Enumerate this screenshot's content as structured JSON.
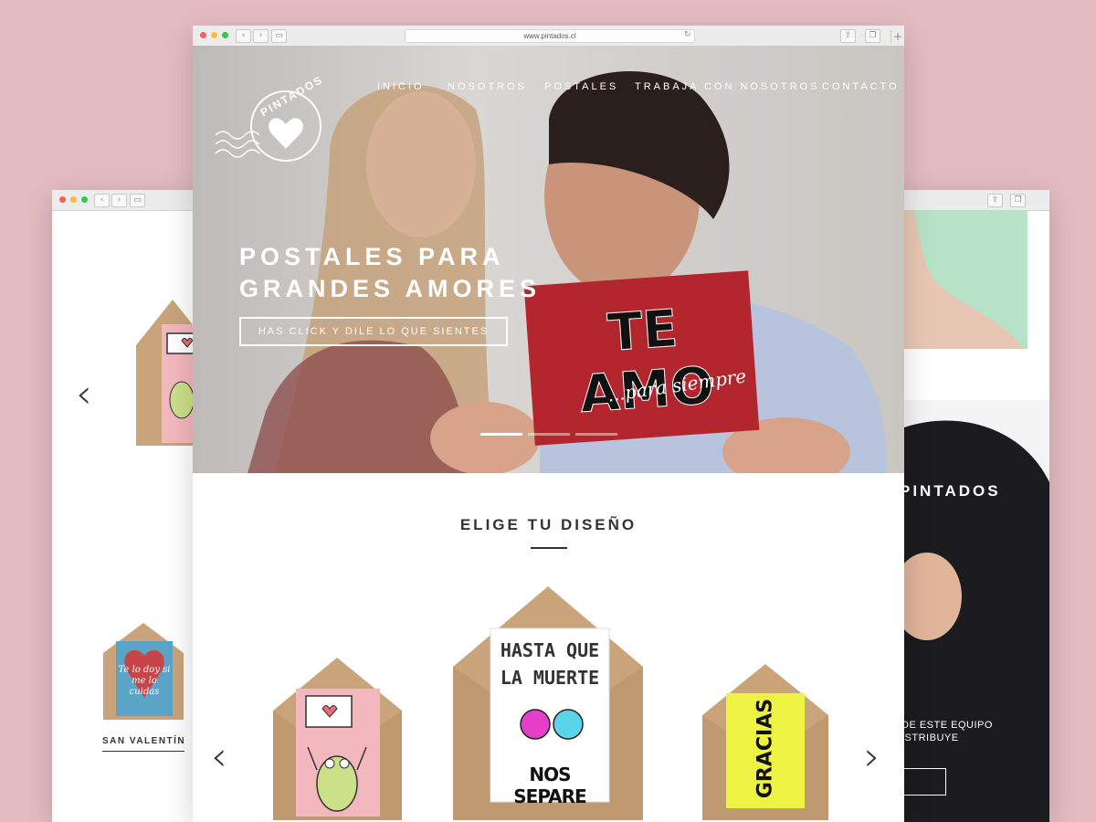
{
  "browser": {
    "url": "www.pintados.cl",
    "tab_plus": "+"
  },
  "nav": {
    "items": [
      "INICIO",
      "NOSOTROS",
      "POSTALES",
      "TRABAJA CON NOSOTROS",
      "CONTACTO"
    ]
  },
  "logo": {
    "text": "PINTADOS"
  },
  "hero": {
    "title_line1": "POSTALES PARA",
    "title_line2": "GRANDES AMORES",
    "cta": "HAS CLICK Y DILE LO QUE SIENTES",
    "card_text": "TE AMO",
    "card_subtext": "...para siempre",
    "slides_total": 3,
    "active_slide": 1
  },
  "section": {
    "title": "ELIGE TU DISEÑO"
  },
  "designs": [
    {
      "text_top": "",
      "text_bottom": "",
      "color": "#f2b8bd"
    },
    {
      "text_top": "HASTA QUE",
      "text_mid": "LA MUERTE",
      "text_bottom": "NOS SEPARE",
      "color": "#ffffff"
    },
    {
      "text_top": "GRACIAS",
      "color": "#eef242"
    }
  ],
  "left_window": {
    "card_text": "Te lo doy si me lo cuidas",
    "label": "SAN VALENTÍN"
  },
  "right_window": {
    "heading": "PINTADOS",
    "body_line1": "DE ESTE EQUIPO",
    "body_line2": "ISTRIBUYE"
  },
  "icons": {
    "prev": "chevron-left-icon",
    "next": "chevron-right-icon"
  },
  "colors": {
    "accent_red": "#b3262d",
    "kraft": "#c9a47a",
    "mint": "#b6e3c7"
  }
}
